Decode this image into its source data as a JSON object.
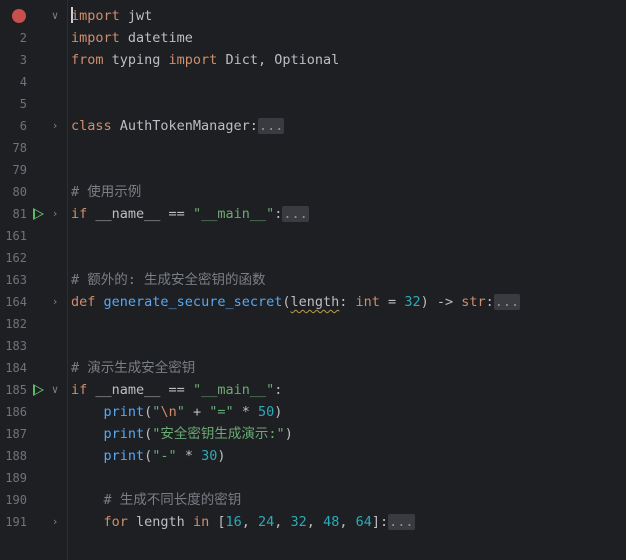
{
  "editor": {
    "lines": [
      {
        "num": "",
        "breakpoint": true,
        "fold": "v",
        "run": false,
        "tokens": [
          {
            "t": "import",
            "c": "kw"
          },
          {
            "t": " jwt",
            "c": ""
          }
        ],
        "caret": true
      },
      {
        "num": "2",
        "tokens": [
          {
            "t": "import",
            "c": "kw"
          },
          {
            "t": " datetime",
            "c": ""
          }
        ]
      },
      {
        "num": "3",
        "tokens": [
          {
            "t": "from",
            "c": "kw"
          },
          {
            "t": " typing ",
            "c": ""
          },
          {
            "t": "import",
            "c": "kw"
          },
          {
            "t": " Dict, Optional",
            "c": ""
          }
        ]
      },
      {
        "num": "4",
        "tokens": []
      },
      {
        "num": "5",
        "tokens": []
      },
      {
        "num": "6",
        "fold": ">",
        "tokens": [
          {
            "t": "class",
            "c": "kw"
          },
          {
            "t": " AuthTokenManager:",
            "c": ""
          },
          {
            "t": "...",
            "c": "fold-ph"
          }
        ]
      },
      {
        "num": "78",
        "tokens": []
      },
      {
        "num": "79",
        "tokens": []
      },
      {
        "num": "80",
        "tokens": [
          {
            "t": "# 使用示例",
            "c": "cmt"
          }
        ]
      },
      {
        "num": "81",
        "run": true,
        "fold": ">",
        "tokens": [
          {
            "t": "if",
            "c": "kw"
          },
          {
            "t": " __name__ == ",
            "c": ""
          },
          {
            "t": "\"__main__\"",
            "c": "str"
          },
          {
            "t": ":",
            "c": ""
          },
          {
            "t": "...",
            "c": "fold-ph"
          }
        ]
      },
      {
        "num": "161",
        "tokens": []
      },
      {
        "num": "162",
        "tokens": []
      },
      {
        "num": "163",
        "tokens": [
          {
            "t": "# 额外的: 生成安全密钥的函数",
            "c": "cmt"
          }
        ]
      },
      {
        "num": "164",
        "fold": ">",
        "tokens": [
          {
            "t": "def",
            "c": "kw"
          },
          {
            "t": " ",
            "c": ""
          },
          {
            "t": "generate_secure_secret",
            "c": "fn"
          },
          {
            "t": "(",
            "c": ""
          },
          {
            "t": "length",
            "c": "param"
          },
          {
            "t": ": ",
            "c": ""
          },
          {
            "t": "int",
            "c": "kw"
          },
          {
            "t": " = ",
            "c": ""
          },
          {
            "t": "32",
            "c": "num"
          },
          {
            "t": ") -> ",
            "c": ""
          },
          {
            "t": "str",
            "c": "kw"
          },
          {
            "t": ":",
            "c": ""
          },
          {
            "t": "...",
            "c": "fold-ph"
          }
        ]
      },
      {
        "num": "182",
        "tokens": []
      },
      {
        "num": "183",
        "tokens": []
      },
      {
        "num": "184",
        "tokens": [
          {
            "t": "# 演示生成安全密钥",
            "c": "cmt"
          }
        ]
      },
      {
        "num": "185",
        "run": true,
        "fold": "v",
        "tokens": [
          {
            "t": "if",
            "c": "kw"
          },
          {
            "t": " __name__ == ",
            "c": ""
          },
          {
            "t": "\"__main__\"",
            "c": "str"
          },
          {
            "t": ":",
            "c": ""
          }
        ]
      },
      {
        "num": "186",
        "tokens": [
          {
            "t": "    ",
            "c": ""
          },
          {
            "t": "print",
            "c": "fn"
          },
          {
            "t": "(",
            "c": ""
          },
          {
            "t": "\"",
            "c": "str"
          },
          {
            "t": "\\n",
            "c": "esc"
          },
          {
            "t": "\"",
            "c": "str"
          },
          {
            "t": " + ",
            "c": ""
          },
          {
            "t": "\"=\"",
            "c": "str"
          },
          {
            "t": " * ",
            "c": ""
          },
          {
            "t": "50",
            "c": "num"
          },
          {
            "t": ")",
            "c": ""
          }
        ]
      },
      {
        "num": "187",
        "tokens": [
          {
            "t": "    ",
            "c": ""
          },
          {
            "t": "print",
            "c": "fn"
          },
          {
            "t": "(",
            "c": ""
          },
          {
            "t": "\"安全密钥生成演示:\"",
            "c": "str"
          },
          {
            "t": ")",
            "c": ""
          }
        ]
      },
      {
        "num": "188",
        "tokens": [
          {
            "t": "    ",
            "c": ""
          },
          {
            "t": "print",
            "c": "fn"
          },
          {
            "t": "(",
            "c": ""
          },
          {
            "t": "\"-\"",
            "c": "str"
          },
          {
            "t": " * ",
            "c": ""
          },
          {
            "t": "30",
            "c": "num"
          },
          {
            "t": ")",
            "c": ""
          }
        ]
      },
      {
        "num": "189",
        "tokens": []
      },
      {
        "num": "190",
        "tokens": [
          {
            "t": "    ",
            "c": ""
          },
          {
            "t": "# 生成不同长度的密钥",
            "c": "cmt"
          }
        ]
      },
      {
        "num": "191",
        "fold": ">",
        "tokens": [
          {
            "t": "    ",
            "c": ""
          },
          {
            "t": "for",
            "c": "kw"
          },
          {
            "t": " length ",
            "c": ""
          },
          {
            "t": "in",
            "c": "kw"
          },
          {
            "t": " [",
            "c": ""
          },
          {
            "t": "16",
            "c": "num"
          },
          {
            "t": ", ",
            "c": ""
          },
          {
            "t": "24",
            "c": "num"
          },
          {
            "t": ", ",
            "c": ""
          },
          {
            "t": "32",
            "c": "num"
          },
          {
            "t": ", ",
            "c": ""
          },
          {
            "t": "48",
            "c": "num"
          },
          {
            "t": ", ",
            "c": ""
          },
          {
            "t": "64",
            "c": "num"
          },
          {
            "t": "]:",
            "c": ""
          },
          {
            "t": "...",
            "c": "fold-ph"
          }
        ]
      }
    ]
  },
  "colors": {
    "background": "#1e1f22",
    "keyword": "#cf8e6d",
    "function": "#56a8f5",
    "string": "#6aab73",
    "number": "#2aacb8",
    "comment": "#7a7e85",
    "text": "#bcbec4",
    "line_number": "#6f737a",
    "run_icon": "#5fb865",
    "breakpoint": "#c94f4f"
  }
}
